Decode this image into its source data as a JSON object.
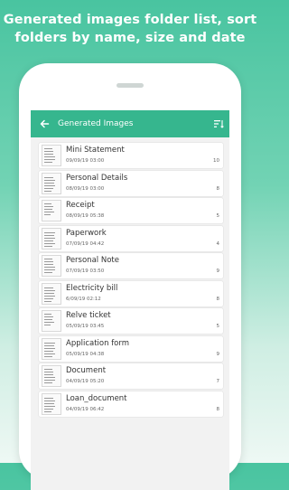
{
  "promo": {
    "line1": "Generated images folder list, sort",
    "line2": "folders by name, size and date"
  },
  "appbar": {
    "title": "Generated Images"
  },
  "folders": [
    {
      "name": "Mini Statement",
      "date": "09/09/19  03:00",
      "count": "10"
    },
    {
      "name": "Personal Details",
      "date": "08/09/19  03:00",
      "count": "8"
    },
    {
      "name": "Receipt",
      "date": "08/09/19  05:38",
      "count": "5"
    },
    {
      "name": "Paperwork",
      "date": "07/09/19  04:42",
      "count": "4"
    },
    {
      "name": "Personal Note",
      "date": "07/09/19  03:50",
      "count": "9"
    },
    {
      "name": "Electricity bill",
      "date": "6/09/19  02:12",
      "count": "8"
    },
    {
      "name": "Relve ticket",
      "date": "05/09/19  03:45",
      "count": "5"
    },
    {
      "name": "Application form",
      "date": "05/09/19  04:38",
      "count": "9"
    },
    {
      "name": "Document",
      "date": "04/09/19  05:20",
      "count": "7"
    },
    {
      "name": "Loan_document",
      "date": "04/09/19  06:42",
      "count": "8"
    }
  ],
  "colors": {
    "accent": "#36b68e",
    "background": "#49c4a0"
  },
  "icons": {
    "back": "arrow-left-icon",
    "sort": "sort-icon",
    "thumb": "document-thumbnail-icon"
  }
}
